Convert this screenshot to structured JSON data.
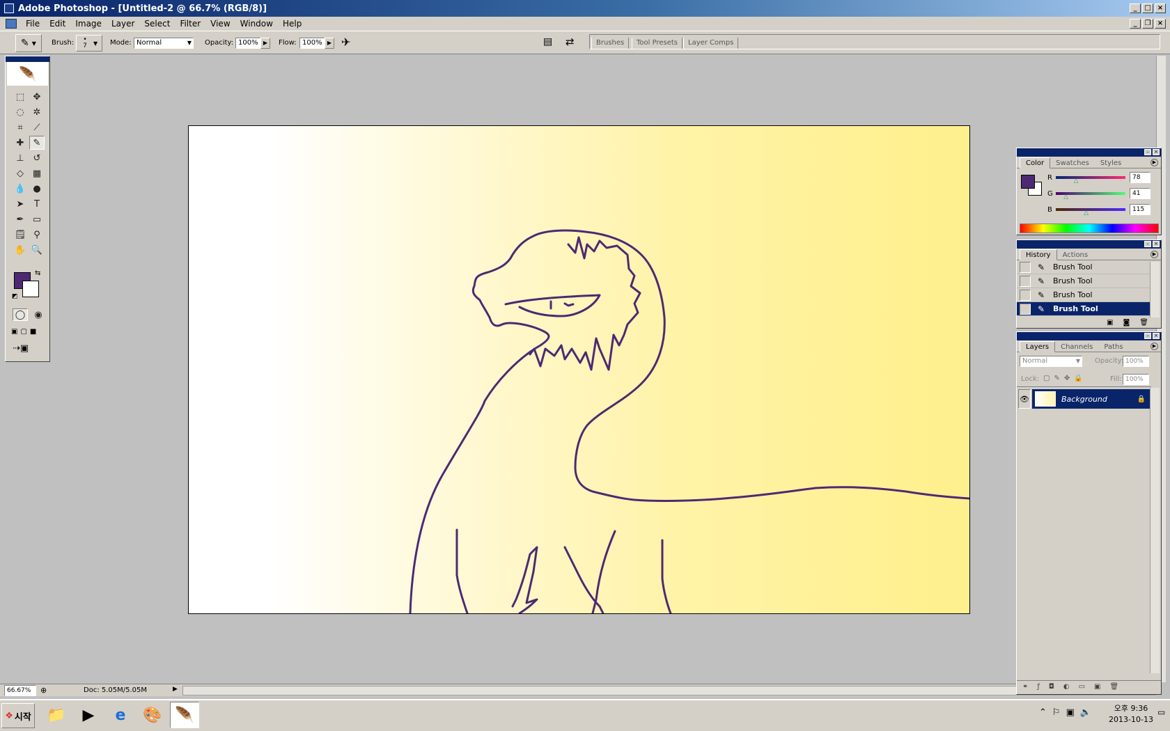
{
  "window": {
    "title": "Adobe Photoshop - [Untitled-2 @ 66.7% (RGB/8)]"
  },
  "menu": [
    "File",
    "Edit",
    "Image",
    "Layer",
    "Select",
    "Filter",
    "View",
    "Window",
    "Help"
  ],
  "options": {
    "brush_label": "Brush:",
    "brush_size": "7",
    "mode_label": "Mode:",
    "mode_value": "Normal",
    "opacity_label": "Opacity:",
    "opacity_value": "100%",
    "flow_label": "Flow:",
    "flow_value": "100%"
  },
  "palette_well": {
    "tabs": [
      "Brushes",
      "Tool Presets",
      "Layer Comps"
    ]
  },
  "colors": {
    "foreground": "#4e2973",
    "background": "#ffffff",
    "line": "#4e2973"
  },
  "color_panel": {
    "tabs": [
      "Color",
      "Swatches",
      "Styles"
    ],
    "channels": [
      {
        "label": "R",
        "value": "78",
        "level": 0.306
      },
      {
        "label": "G",
        "value": "41",
        "level": 0.161
      },
      {
        "label": "B",
        "value": "115",
        "level": 0.451
      }
    ]
  },
  "history_panel": {
    "tabs": [
      "History",
      "Actions"
    ],
    "items": [
      {
        "label": "Brush Tool",
        "selected": false
      },
      {
        "label": "Brush Tool",
        "selected": false
      },
      {
        "label": "Brush Tool",
        "selected": false
      },
      {
        "label": "Brush Tool",
        "selected": true
      }
    ]
  },
  "layers_panel": {
    "tabs": [
      "Layers",
      "Channels",
      "Paths"
    ],
    "blend_mode": "Normal",
    "opacity_label": "Opacity:",
    "opacity_value": "100%",
    "lock_label": "Lock:",
    "fill_label": "Fill:",
    "fill_value": "100%",
    "layers": [
      {
        "name": "Background",
        "locked": true,
        "visible": true
      }
    ]
  },
  "status": {
    "zoom": "66.67%",
    "doc": "Doc: 5.05M/5.05M"
  },
  "taskbar": {
    "start_label": "시작",
    "clock_time": "오후 9:36",
    "clock_date": "2013-10-13"
  }
}
